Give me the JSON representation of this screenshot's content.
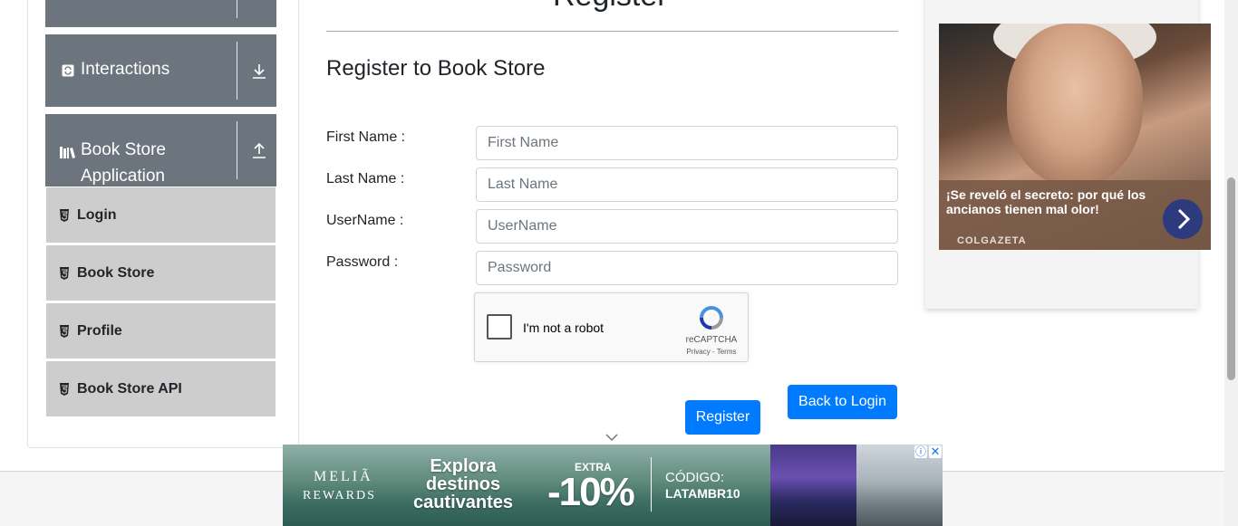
{
  "page_heading_partial": "Register",
  "sidebar": {
    "groups": [
      {
        "label": "",
        "icon": "collapsed-group-icon"
      },
      {
        "label": "Interactions",
        "icon": "refresh-icon",
        "arrow": "download-arrow-icon"
      },
      {
        "label_line1": "Book Store",
        "label_line2": "Application",
        "icon": "books-icon",
        "arrow": "upload-arrow-icon"
      }
    ],
    "items": [
      {
        "label": "Login",
        "icon": "html5-icon"
      },
      {
        "label": "Book Store",
        "icon": "html5-icon"
      },
      {
        "label": "Profile",
        "icon": "html5-icon"
      },
      {
        "label": "Book Store API",
        "icon": "html5-icon"
      }
    ]
  },
  "form": {
    "title": "Register to Book Store",
    "fields": [
      {
        "label": "First Name :",
        "placeholder": "First Name",
        "value": ""
      },
      {
        "label": "Last Name :",
        "placeholder": "Last Name",
        "value": ""
      },
      {
        "label": "UserName :",
        "placeholder": "UserName",
        "value": ""
      },
      {
        "label": "Password :",
        "placeholder": "Password",
        "value": ""
      }
    ],
    "captcha": {
      "label": "I'm not a robot",
      "brand": "reCAPTCHA",
      "links": "Privacy - Terms"
    },
    "register_label": "Register",
    "back_label": "Back to Login"
  },
  "right_ad": {
    "caption": "¡Se reveló el secreto: por qué los ancianos tienen mal olor!",
    "source": "COLGAZETA"
  },
  "banner_ad": {
    "logo_line1": "MELIÃ",
    "logo_line2": "REWARDS",
    "headline": "Explora destinos cautivantes",
    "extra": "EXTRA",
    "discount": "-10%",
    "code_label": "CÓDIGO:",
    "code_value": "LATAMBR10",
    "adchoices_icon": "ⓘ",
    "close_icon": "✕"
  },
  "colors": {
    "accent": "#007bff",
    "sidebar_group": "#6c757d",
    "sidebar_item": "#cdcdcd"
  }
}
